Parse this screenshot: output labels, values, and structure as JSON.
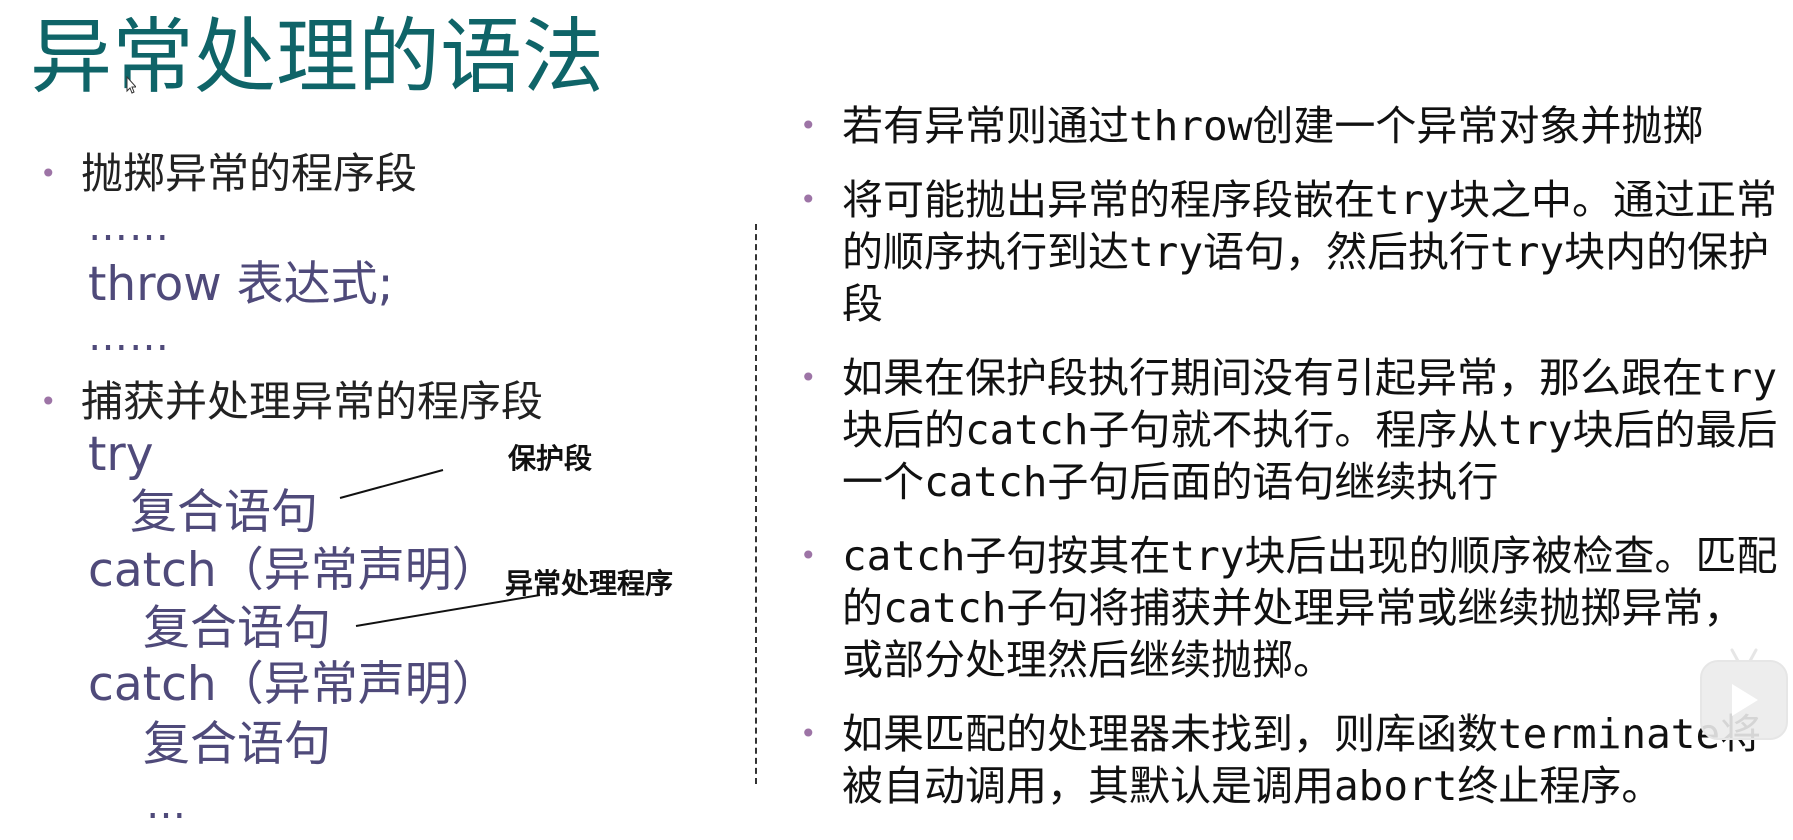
{
  "title": "异常处理的语法",
  "left": {
    "throw_heading": "抛掷异常的程序段",
    "dots1": "……",
    "throw_expr": "throw 表达式;",
    "dots2": "……",
    "catch_heading": "捕获并处理异常的程序段",
    "try_kw": "try",
    "compound1": "复合语句",
    "catch1": "catch（异常声明）",
    "compound2": "复合语句",
    "catch2": "catch（异常声明）",
    "compound3": "复合语句",
    "ellipsis": "…",
    "annot_protect": "保护段",
    "annot_handler": "异常处理程序"
  },
  "right": {
    "items": [
      "若有异常则通过throw创建一个异常对象并抛掷",
      "将可能抛出异常的程序段嵌在try块之中。通过正常的顺序执行到达try语句，然后执行try块内的保护段",
      "如果在保护段执行期间没有引起异常，那么跟在try块后的catch子句就不执行。程序从try块后的最后一个catch子句后面的语句继续执行",
      "catch子句按其在try块后出现的顺序被检查。匹配的catch子句将捕获并处理异常或继续抛掷异常，或部分处理然后继续抛掷。",
      "如果匹配的处理器未找到，则库函数terminate将被自动调用，其默认是调用abort终止程序。"
    ]
  },
  "colors": {
    "title": "#0f6468",
    "bullet": "#9d74a6",
    "code": "#4f4a7a",
    "text": "#111111"
  },
  "icons": {
    "cursor": "mouse-pointer-icon",
    "play": "play-icon"
  }
}
